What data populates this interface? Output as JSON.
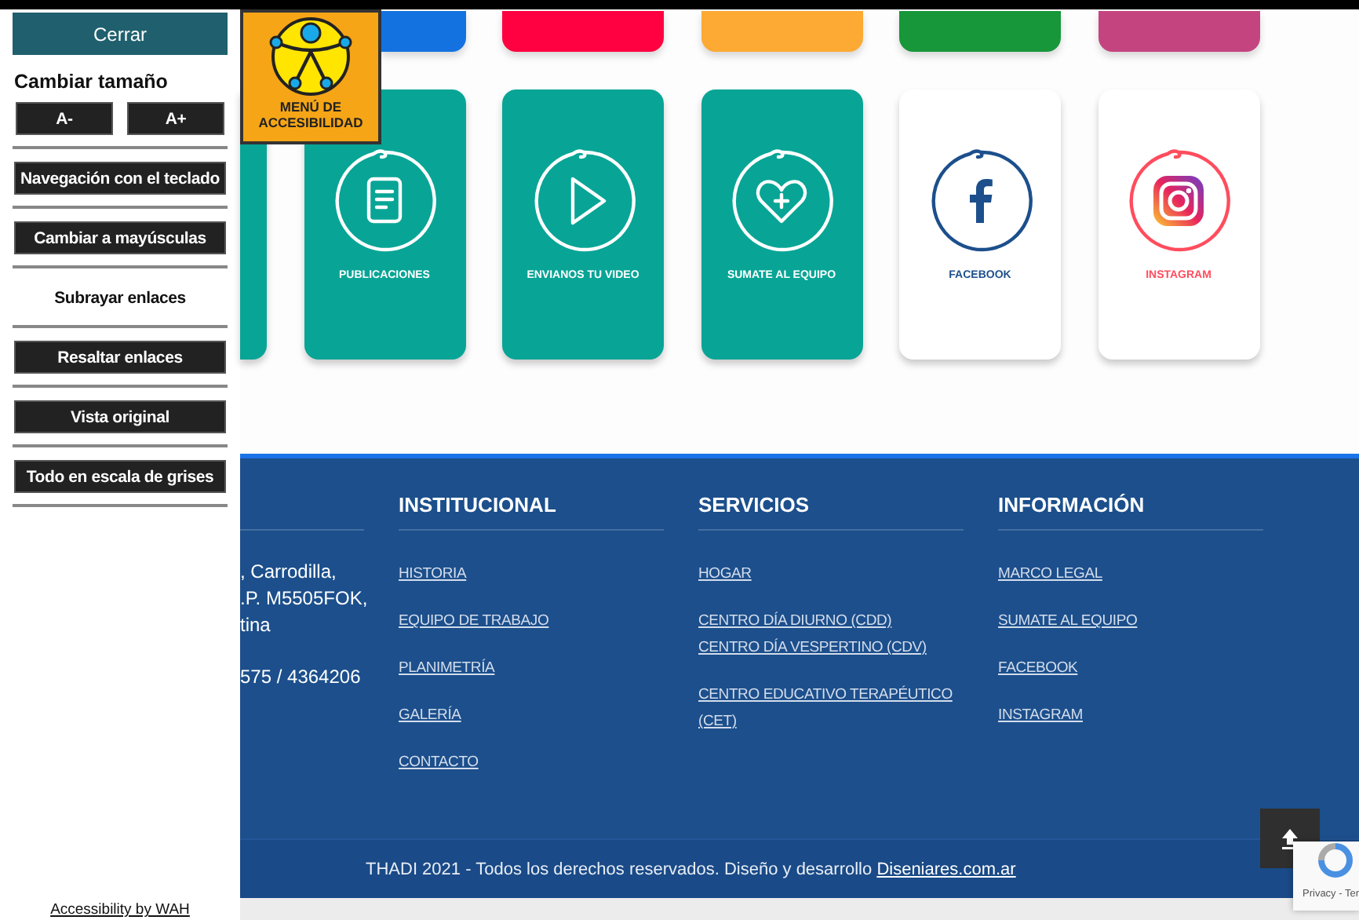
{
  "accessibility_panel": {
    "close": "Cerrar",
    "size_heading": "Cambiar tamaño",
    "size_buttons": [
      "A-",
      "A+"
    ],
    "options": [
      {
        "label": "Navegación con el teclado",
        "active": false
      },
      {
        "label": "Cambiar a mayúsculas",
        "active": false
      },
      {
        "label": "Subrayar enlaces",
        "active": true
      },
      {
        "label": "Resaltar enlaces",
        "active": false
      },
      {
        "label": "Vista original",
        "active": false
      },
      {
        "label": "Todo en escala de grises",
        "active": false
      }
    ],
    "credit": "Accessibility by WAH"
  },
  "accessibility_badge": {
    "label": "MENÚ DE ACCESIBILIDAD"
  },
  "top_tabs": [
    {
      "color": "#1472e0"
    },
    {
      "color": "#ff0040"
    },
    {
      "color": "#fcaa33"
    },
    {
      "color": "#17963a"
    },
    {
      "color": "#c44480"
    }
  ],
  "cards": [
    {
      "label": "PUBLICACIONES",
      "kind": "document",
      "color": "#08a596"
    },
    {
      "label": "ENVIANOS TU VIDEO",
      "kind": "play",
      "color": "#08a596"
    },
    {
      "label": "SUMATE AL EQUIPO",
      "kind": "heart",
      "color": "#08a596"
    },
    {
      "label": "FACEBOOK",
      "kind": "facebook",
      "color": "#1c4f8c"
    },
    {
      "label": "INSTAGRAM",
      "kind": "instagram",
      "color": "#ff4d5e"
    }
  ],
  "footer": {
    "contact_lines": [
      ", Carrodilla,",
      ".P. M5505FOK,",
      "tina",
      "575 / 4364206"
    ],
    "columns": [
      {
        "heading": "INSTITUCIONAL",
        "links": [
          [
            "HISTORIA"
          ],
          [
            "EQUIPO DE TRABAJO"
          ],
          [
            "PLANIMETRÍA"
          ],
          [
            "GALERÍA"
          ],
          [
            "CONTACTO"
          ]
        ]
      },
      {
        "heading": "SERVICIOS",
        "links": [
          [
            "HOGAR"
          ],
          [
            "CENTRO DÍA DIURNO (CDD)",
            "CENTRO DÍA VESPERTINO (CDV)"
          ],
          [
            "CENTRO EDUCATIVO TERAPÉUTICO (CET)"
          ]
        ]
      },
      {
        "heading": "INFORMACIÓN",
        "links": [
          [
            "MARCO LEGAL"
          ],
          [
            "SUMATE AL EQUIPO"
          ],
          [
            "FACEBOOK"
          ],
          [
            "INSTAGRAM"
          ]
        ]
      }
    ],
    "copyright": "THADI 2021 - Todos los derechos reservados. Diseño y desarrollo",
    "credit_link": "Diseniares.com.ar"
  },
  "recaptcha": {
    "text": "Privacy - Ter"
  }
}
